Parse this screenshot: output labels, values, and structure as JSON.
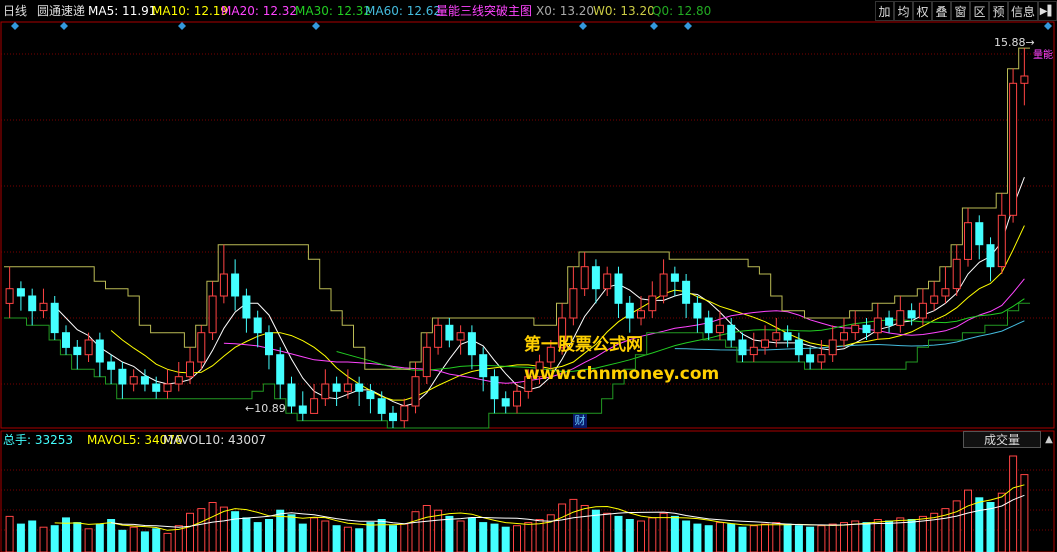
{
  "header": {
    "period": "日线",
    "stock_name": "圆通速递",
    "indicators": [
      {
        "label": "MA5: 11.91",
        "color": "#ffffff"
      },
      {
        "label": "MA10: 12.19",
        "color": "#ffff00"
      },
      {
        "label": "MA20: 12.32",
        "color": "#ff44ff"
      },
      {
        "label": "MA30: 12.32",
        "color": "#22cc22"
      },
      {
        "label": "MA60: 12.62",
        "color": "#44bbdd"
      },
      {
        "label": "量能三线突破主图",
        "color": "#ff44ff"
      },
      {
        "label": "X0: 13.20",
        "color": "#aaaaaa"
      },
      {
        "label": "W0: 13.20",
        "color": "#cccc44"
      },
      {
        "label": "Q0: 12.80",
        "color": "#22aa22"
      }
    ]
  },
  "toolbar": [
    "加",
    "均",
    "权",
    "叠",
    "窗",
    "区",
    "预",
    "信息",
    "▶▌"
  ],
  "price_labels": {
    "high": "15.88",
    "low": "10.89",
    "right_tag": "量能"
  },
  "watermark": {
    "line1": "第一股票公式网",
    "line2": "www.chnmoney.com"
  },
  "cai_badge": "财",
  "volume": {
    "total": "总手: 33253",
    "mavol5": "MAVOL5: 34076",
    "mavol10": "MAVOL10: 43007",
    "tab": "成交量",
    "arrow": "▲"
  },
  "colors": {
    "up": "#ff4444",
    "down": "#44ffff",
    "grid": "#7a0000",
    "border": "#aa0000"
  },
  "chart_data": {
    "type": "candlestick",
    "candles": [
      [
        12.4,
        12.6,
        12.9,
        12.2
      ],
      [
        12.6,
        12.5,
        12.7,
        12.3
      ],
      [
        12.5,
        12.3,
        12.6,
        12.1
      ],
      [
        12.3,
        12.4,
        12.6,
        12.2
      ],
      [
        12.4,
        12.0,
        12.5,
        11.9
      ],
      [
        12.0,
        11.8,
        12.1,
        11.7
      ],
      [
        11.8,
        11.7,
        11.9,
        11.5
      ],
      [
        11.7,
        11.9,
        12.0,
        11.6
      ],
      [
        11.9,
        11.6,
        12.0,
        11.4
      ],
      [
        11.6,
        11.5,
        11.7,
        11.3
      ],
      [
        11.5,
        11.3,
        11.6,
        11.1
      ],
      [
        11.3,
        11.4,
        11.5,
        11.2
      ],
      [
        11.4,
        11.3,
        11.5,
        11.2
      ],
      [
        11.3,
        11.2,
        11.4,
        11.1
      ],
      [
        11.2,
        11.3,
        11.5,
        11.1
      ],
      [
        11.3,
        11.4,
        11.6,
        11.2
      ],
      [
        11.4,
        11.6,
        11.8,
        11.3
      ],
      [
        11.6,
        12.0,
        12.1,
        11.5
      ],
      [
        12.0,
        12.5,
        12.7,
        11.9
      ],
      [
        12.5,
        12.8,
        13.2,
        12.4
      ],
      [
        12.8,
        12.5,
        13.0,
        12.3
      ],
      [
        12.5,
        12.2,
        12.6,
        12.0
      ],
      [
        12.2,
        12.0,
        12.3,
        11.8
      ],
      [
        12.0,
        11.7,
        12.1,
        11.5
      ],
      [
        11.7,
        11.3,
        11.8,
        11.1
      ],
      [
        11.3,
        11.0,
        11.4,
        10.9
      ],
      [
        11.0,
        10.9,
        11.2,
        10.8
      ],
      [
        10.9,
        11.1,
        11.3,
        10.9
      ],
      [
        11.1,
        11.3,
        11.5,
        11.0
      ],
      [
        11.3,
        11.2,
        11.4,
        11.0
      ],
      [
        11.2,
        11.3,
        11.5,
        11.1
      ],
      [
        11.3,
        11.2,
        11.4,
        11.0
      ],
      [
        11.2,
        11.1,
        11.3,
        10.9
      ],
      [
        11.1,
        10.9,
        11.2,
        10.8
      ],
      [
        10.9,
        10.8,
        11.0,
        10.7
      ],
      [
        10.8,
        11.0,
        11.1,
        10.7
      ],
      [
        11.0,
        11.4,
        11.6,
        10.9
      ],
      [
        11.4,
        11.8,
        12.0,
        11.3
      ],
      [
        11.8,
        12.1,
        12.2,
        11.7
      ],
      [
        12.1,
        11.9,
        12.2,
        11.8
      ],
      [
        11.9,
        12.0,
        12.1,
        11.7
      ],
      [
        12.0,
        11.7,
        12.1,
        11.5
      ],
      [
        11.7,
        11.4,
        11.8,
        11.2
      ],
      [
        11.4,
        11.1,
        11.5,
        10.9
      ],
      [
        11.1,
        11.0,
        11.2,
        10.9
      ],
      [
        11.0,
        11.2,
        11.3,
        10.9
      ],
      [
        11.2,
        11.4,
        11.5,
        11.1
      ],
      [
        11.4,
        11.6,
        11.7,
        11.3
      ],
      [
        11.6,
        11.8,
        11.9,
        11.5
      ],
      [
        11.8,
        12.2,
        12.4,
        11.7
      ],
      [
        12.2,
        12.6,
        12.9,
        12.1
      ],
      [
        12.6,
        12.9,
        13.1,
        12.5
      ],
      [
        12.9,
        12.6,
        13.0,
        12.4
      ],
      [
        12.6,
        12.8,
        12.9,
        12.5
      ],
      [
        12.8,
        12.4,
        12.9,
        12.2
      ],
      [
        12.4,
        12.2,
        12.5,
        12.0
      ],
      [
        12.2,
        12.3,
        12.5,
        12.1
      ],
      [
        12.3,
        12.5,
        12.7,
        12.2
      ],
      [
        12.5,
        12.8,
        13.0,
        12.4
      ],
      [
        12.8,
        12.7,
        12.9,
        12.5
      ],
      [
        12.7,
        12.4,
        12.8,
        12.2
      ],
      [
        12.4,
        12.2,
        12.5,
        12.0
      ],
      [
        12.2,
        12.0,
        12.3,
        11.9
      ],
      [
        12.0,
        12.1,
        12.3,
        11.9
      ],
      [
        12.1,
        11.9,
        12.2,
        11.8
      ],
      [
        11.9,
        11.7,
        12.0,
        11.6
      ],
      [
        11.7,
        11.8,
        12.0,
        11.6
      ],
      [
        11.8,
        11.9,
        12.1,
        11.7
      ],
      [
        11.9,
        12.0,
        12.2,
        11.8
      ],
      [
        12.0,
        11.9,
        12.1,
        11.8
      ],
      [
        11.9,
        11.7,
        12.0,
        11.6
      ],
      [
        11.7,
        11.6,
        11.8,
        11.5
      ],
      [
        11.6,
        11.7,
        11.9,
        11.5
      ],
      [
        11.7,
        11.9,
        12.1,
        11.6
      ],
      [
        11.9,
        12.0,
        12.2,
        11.8
      ],
      [
        12.0,
        12.1,
        12.3,
        11.9
      ],
      [
        12.1,
        12.0,
        12.2,
        11.9
      ],
      [
        12.0,
        12.2,
        12.4,
        11.9
      ],
      [
        12.2,
        12.1,
        12.3,
        12.0
      ],
      [
        12.1,
        12.3,
        12.5,
        12.0
      ],
      [
        12.3,
        12.2,
        12.4,
        12.1
      ],
      [
        12.2,
        12.4,
        12.6,
        12.1
      ],
      [
        12.4,
        12.5,
        12.7,
        12.3
      ],
      [
        12.5,
        12.6,
        12.9,
        12.4
      ],
      [
        12.6,
        13.0,
        13.2,
        12.5
      ],
      [
        13.0,
        13.5,
        13.7,
        12.9
      ],
      [
        13.5,
        13.2,
        13.6,
        13.0
      ],
      [
        13.2,
        12.9,
        13.3,
        12.7
      ],
      [
        12.9,
        13.6,
        13.9,
        12.8
      ],
      [
        13.6,
        15.4,
        15.6,
        13.5
      ],
      [
        15.4,
        15.5,
        15.88,
        15.1
      ]
    ],
    "volumes": [
      2.3,
      1.8,
      2.0,
      1.6,
      1.7,
      2.2,
      1.9,
      1.5,
      1.8,
      2.1,
      1.4,
      1.6,
      1.3,
      1.5,
      1.2,
      1.7,
      2.5,
      2.8,
      3.2,
      2.9,
      2.6,
      2.2,
      1.9,
      2.1,
      2.7,
      2.4,
      1.8,
      2.2,
      2.0,
      1.7,
      1.6,
      1.5,
      1.9,
      2.1,
      1.7,
      1.8,
      2.6,
      3.0,
      2.7,
      2.3,
      2.0,
      2.2,
      1.9,
      1.8,
      1.6,
      1.7,
      1.9,
      2.1,
      2.4,
      3.1,
      3.4,
      3.0,
      2.7,
      2.5,
      2.3,
      2.1,
      2.0,
      2.2,
      2.5,
      2.3,
      2.0,
      1.8,
      1.7,
      1.9,
      1.8,
      1.6,
      1.7,
      1.8,
      1.9,
      1.8,
      1.7,
      1.6,
      1.7,
      1.8,
      1.9,
      2.0,
      1.9,
      2.1,
      2.0,
      2.2,
      2.1,
      2.3,
      2.5,
      2.8,
      3.3,
      4.0,
      3.5,
      3.2,
      3.8,
      6.2,
      5.0
    ],
    "price_min": 10.7,
    "price_max": 16.1
  }
}
